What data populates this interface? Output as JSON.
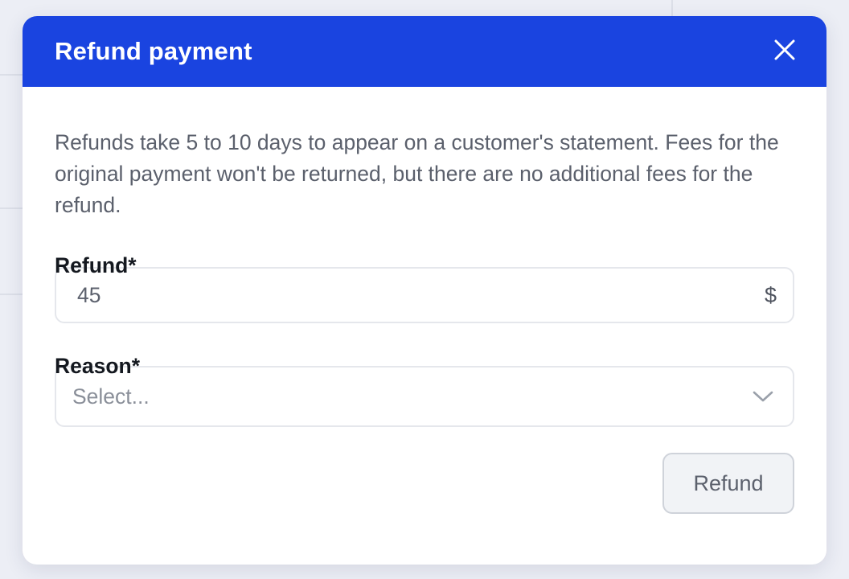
{
  "modal": {
    "title": "Refund payment",
    "description": "Refunds take 5 to 10 days to appear on a customer's statement. Fees for the original payment won't be returned, but there are no additional fees for the refund.",
    "refund_field": {
      "label": "Refund*",
      "value": "45",
      "suffix": "$"
    },
    "reason_field": {
      "label": "Reason*",
      "placeholder": "Select..."
    },
    "submit_label": "Refund"
  },
  "icons": {
    "close": "close-icon",
    "dropdown": "chevron-down-icon"
  },
  "colors": {
    "header": "#1a44e0",
    "button_bg": "#f1f3f6"
  }
}
